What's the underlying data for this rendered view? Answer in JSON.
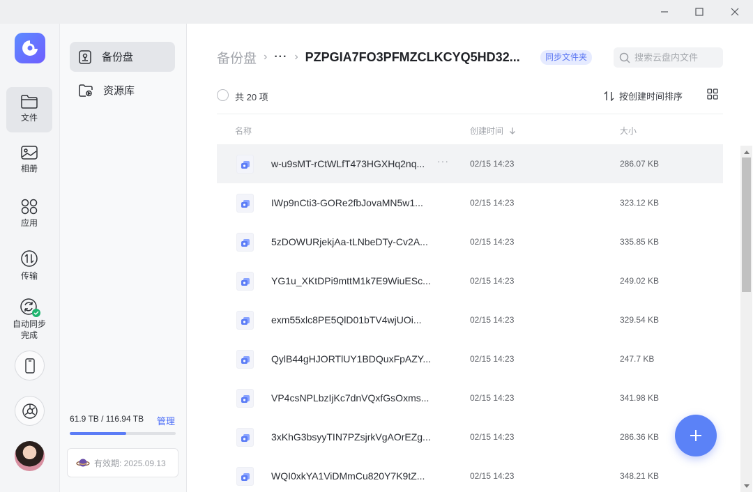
{
  "window": {
    "controls": [
      "minimize",
      "maximize",
      "close"
    ]
  },
  "nav": {
    "items": [
      {
        "label": "文件",
        "icon": "folder-icon",
        "active": true
      },
      {
        "label": "相册",
        "icon": "photo-icon",
        "active": false
      },
      {
        "label": "应用",
        "icon": "apps-icon",
        "active": false
      },
      {
        "label": "传输",
        "icon": "transfer-icon",
        "active": false
      },
      {
        "label": "自动同步\n完成",
        "icon": "sync-icon",
        "active": false
      }
    ],
    "sync_status_color": "#1fb46e",
    "accent": "#5b82f7"
  },
  "panel": {
    "items": [
      {
        "label": "备份盘",
        "icon": "backup-disk-icon",
        "active": true
      },
      {
        "label": "资源库",
        "icon": "library-folder-icon",
        "active": false
      }
    ],
    "storage": {
      "text": "61.9 TB / 116.94 TB",
      "manage_label": "管理",
      "used_fraction": 0.53
    },
    "validity_text": "有效期: 2025.09.13"
  },
  "breadcrumb": {
    "root": "备份盘",
    "sep": "›",
    "more": "···",
    "current": "PZPGIA7FO3PFMZCLKCYQ5HD32..."
  },
  "sync_tag": "同步文件夹",
  "search": {
    "placeholder": "搜索云盘内文件"
  },
  "toolbar": {
    "count": "共 20 项",
    "sort_label": "按创建时间排序"
  },
  "table": {
    "headers": {
      "name": "名称",
      "time": "创建时间",
      "size": "大小"
    },
    "rows": [
      {
        "name": "w-u9sMT-rCtWLfT473HGXHq2nq...",
        "time": "02/15 14:23",
        "size": "286.07 KB"
      },
      {
        "name": "IWp9nCti3-GORe2fbJovaMN5w1...",
        "time": "02/15 14:23",
        "size": "323.12 KB"
      },
      {
        "name": "5zDOWURjekjAa-tLNbeDTy-Cv2A...",
        "time": "02/15 14:23",
        "size": "335.85 KB"
      },
      {
        "name": "YG1u_XKtDPi9mttM1k7E9WiuESc...",
        "time": "02/15 14:23",
        "size": "249.02 KB"
      },
      {
        "name": "exm55xlc8PE5QlD01bTV4wjUOi...",
        "time": "02/15 14:23",
        "size": "329.54 KB"
      },
      {
        "name": "QylB44gHJORTlUY1BDQuxFpAZY...",
        "time": "02/15 14:23",
        "size": "247.7 KB"
      },
      {
        "name": "VP4csNPLbzIjKc7dnVQxfGsOxms...",
        "time": "02/15 14:23",
        "size": "341.98 KB"
      },
      {
        "name": "3xKhG3bsyyTIN7PZsjrkVgAOrEZg...",
        "time": "02/15 14:23",
        "size": "286.36 KB"
      },
      {
        "name": "WQI0xkYA1ViDMmCu820Y7K9tZ...",
        "time": "02/15 14:23",
        "size": "348.21 KB"
      }
    ],
    "row_more": "···"
  }
}
